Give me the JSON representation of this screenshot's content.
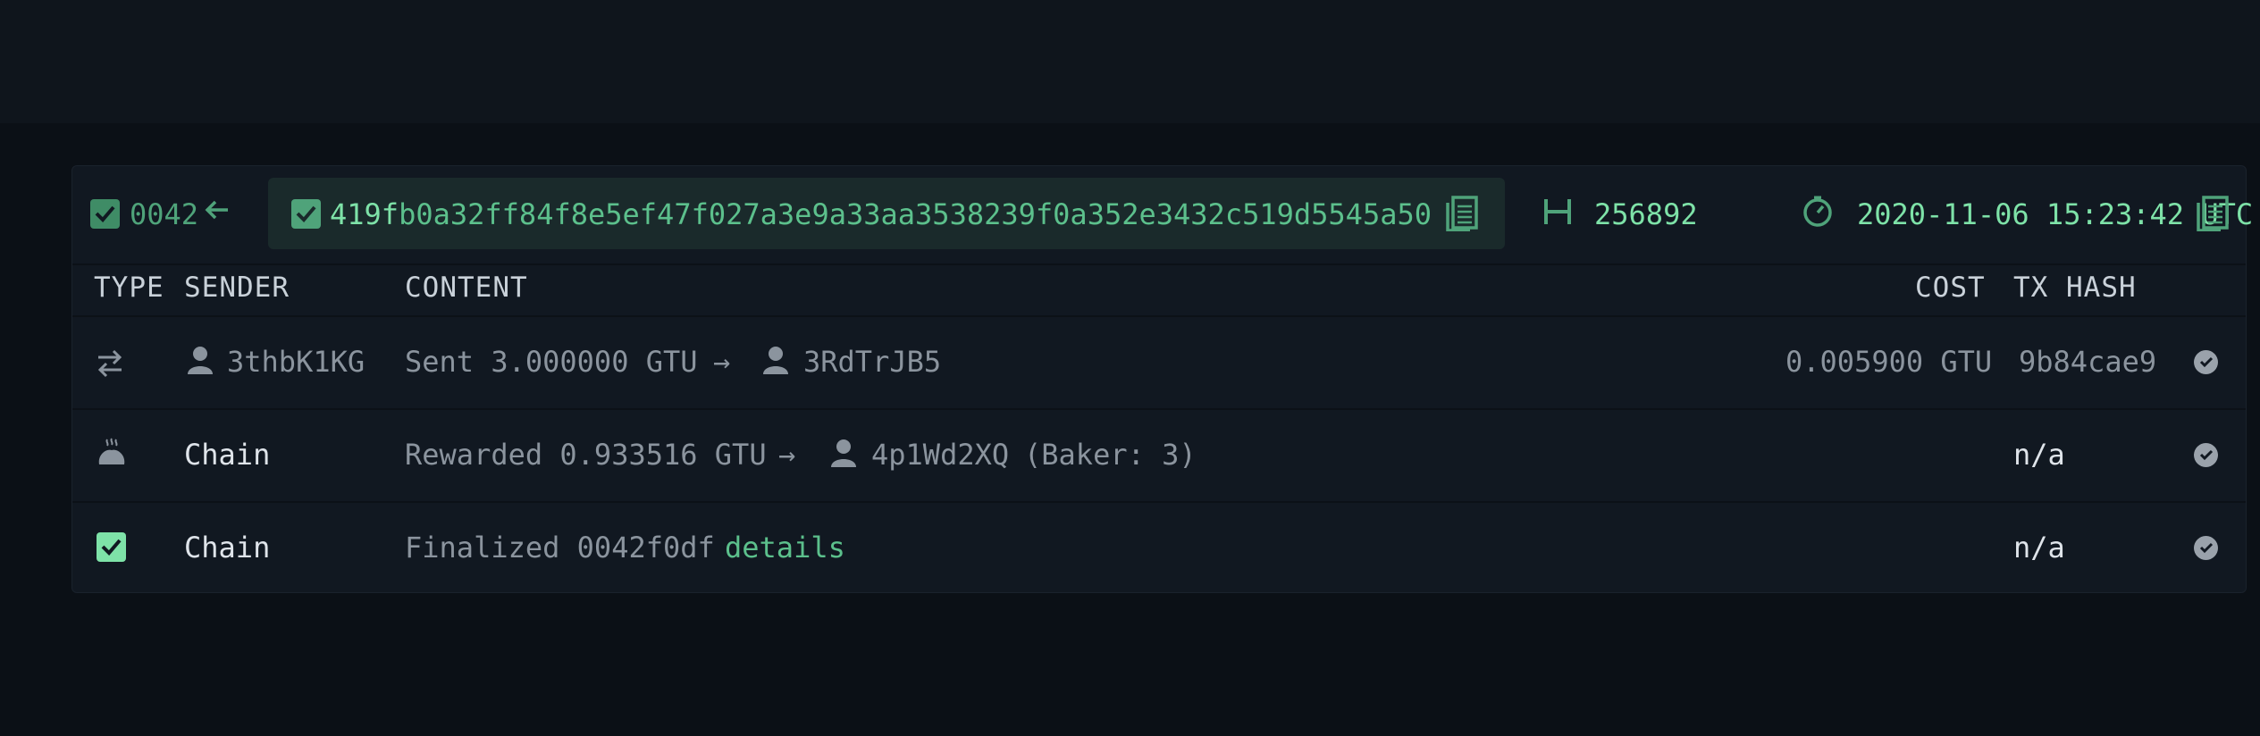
{
  "header": {
    "block_prefix": "0042",
    "block_hash_highlight": "419f",
    "block_hash_rest": "b0a32ff84f8e5ef47f027a3e9a33aa3538239f0a352e3432c519d5545a50",
    "height": "256892",
    "timestamp": "2020-11-06 15:23:42 UTC"
  },
  "columns": {
    "type": "TYPE",
    "sender": "SENDER",
    "content": "CONTENT",
    "cost": "COST",
    "tx_hash": "TX HASH"
  },
  "rows": [
    {
      "type_icon": "transfer-icon",
      "sender": "3thbK1KG",
      "content_prefix": "Sent 3.000000 GTU",
      "arrow": "→",
      "recipient": "3RdTrJB5",
      "cost": "0.005900 GTU",
      "tx_hash": "9b84cae9"
    },
    {
      "type_icon": "bread-icon",
      "sender": "Chain",
      "content_prefix": "Rewarded 0.933516 GTU",
      "arrow": "→",
      "recipient": "4p1Wd2XQ",
      "content_suffix": "(Baker: 3)",
      "tx_hash": "n/a"
    },
    {
      "type_icon": "finalized-check-icon",
      "sender": "Chain",
      "content_prefix": "Finalized 0042f0df",
      "link": "details",
      "tx_hash": "n/a"
    }
  ],
  "colors": {
    "accent": "#5cc08c",
    "background": "#0b1016",
    "panel": "#111821"
  }
}
